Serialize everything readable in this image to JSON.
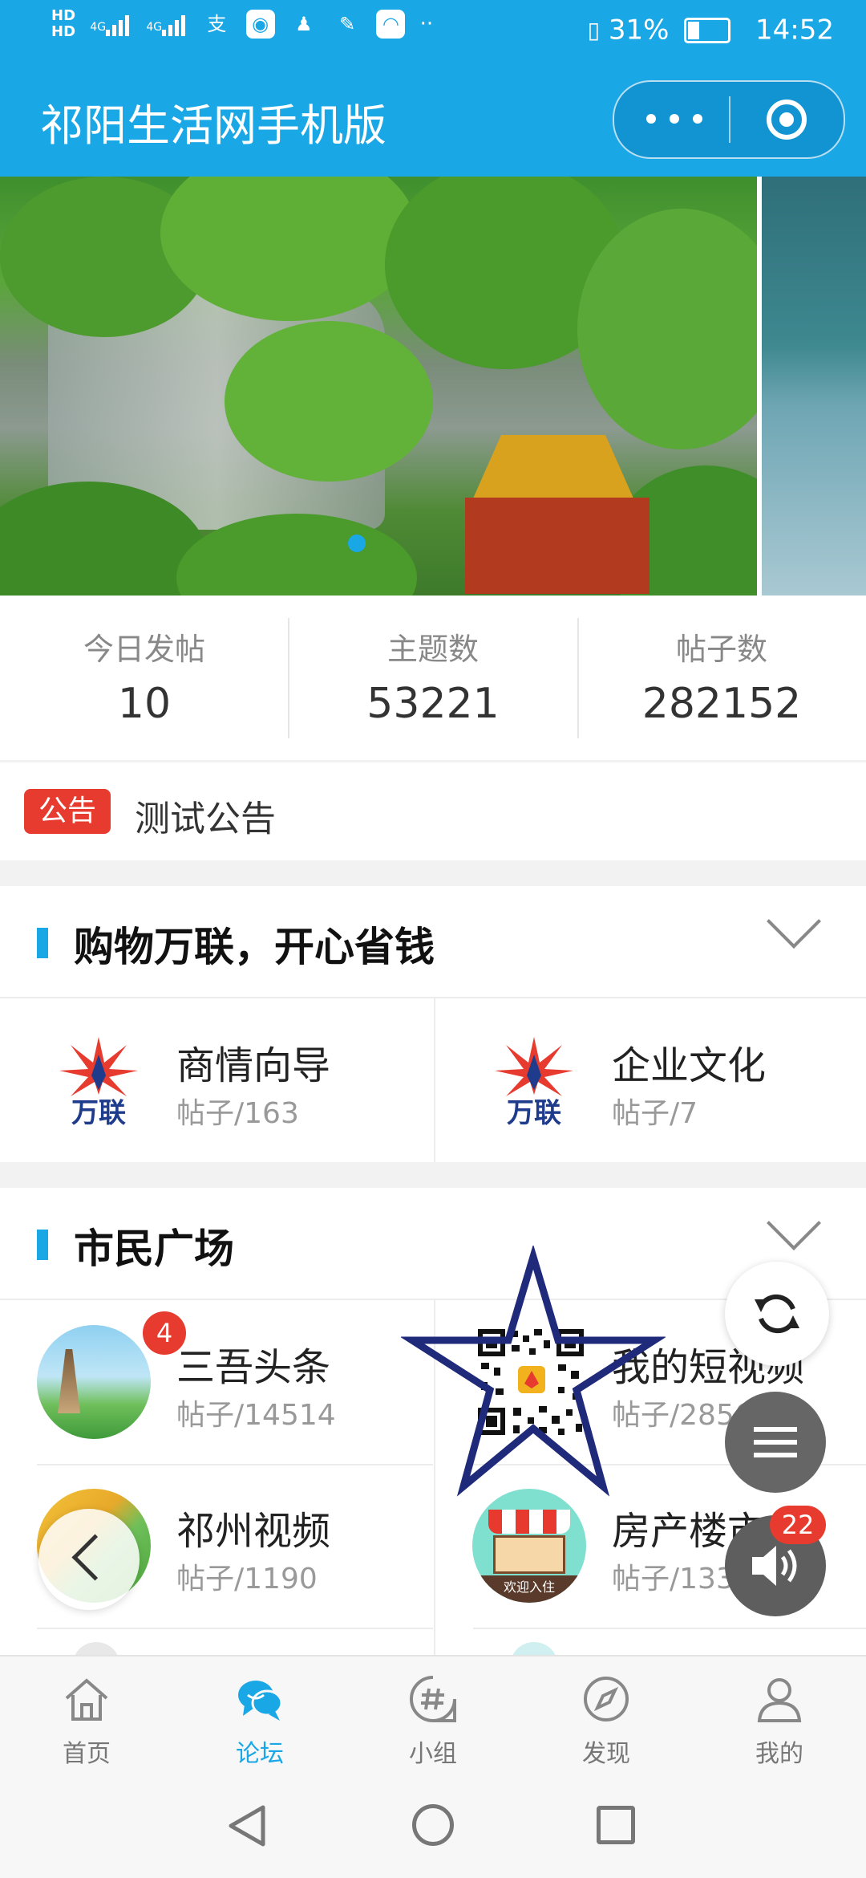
{
  "status_bar": {
    "network_left": "HD",
    "network_left2": "HD",
    "net_type": "4G",
    "net_type2": "4G",
    "battery": "31%",
    "time": "14:52"
  },
  "header": {
    "title": "祁阳生活网手机版"
  },
  "stats": [
    {
      "label": "今日发帖",
      "value": "10"
    },
    {
      "label": "主题数",
      "value": "53221"
    },
    {
      "label": "帖子数",
      "value": "282152"
    }
  ],
  "notice": {
    "badge": "公告",
    "text": "测试公告"
  },
  "sections": [
    {
      "title": "购物万联，开心省钱",
      "items": [
        {
          "title": "商情向导",
          "sub": "帖子/163",
          "logo": "万联"
        },
        {
          "title": "企业文化",
          "sub": "帖子/7",
          "logo": "万联"
        }
      ]
    },
    {
      "title": "市民广场",
      "items": [
        {
          "title": "三吾头条",
          "sub": "帖子/14514",
          "badge": "4"
        },
        {
          "title": "我的短视频",
          "sub": "帖子/2856"
        },
        {
          "title": "祁州视频",
          "sub": "帖子/1190"
        },
        {
          "title": "房产楼市",
          "sub": "帖子/1339",
          "shop_sign": "欢迎入住"
        }
      ]
    }
  ],
  "floating": {
    "sound_badge": "22"
  },
  "tabs": [
    {
      "label": "首页",
      "icon": "home-icon"
    },
    {
      "label": "论坛",
      "icon": "chat-icon"
    },
    {
      "label": "小组",
      "icon": "hashtag-icon"
    },
    {
      "label": "发现",
      "icon": "compass-icon"
    },
    {
      "label": "我的",
      "icon": "user-icon"
    }
  ],
  "colors": {
    "accent": "#1aa7e6",
    "badge_red": "#e63b2e",
    "star_navy": "#1f2a7a"
  }
}
